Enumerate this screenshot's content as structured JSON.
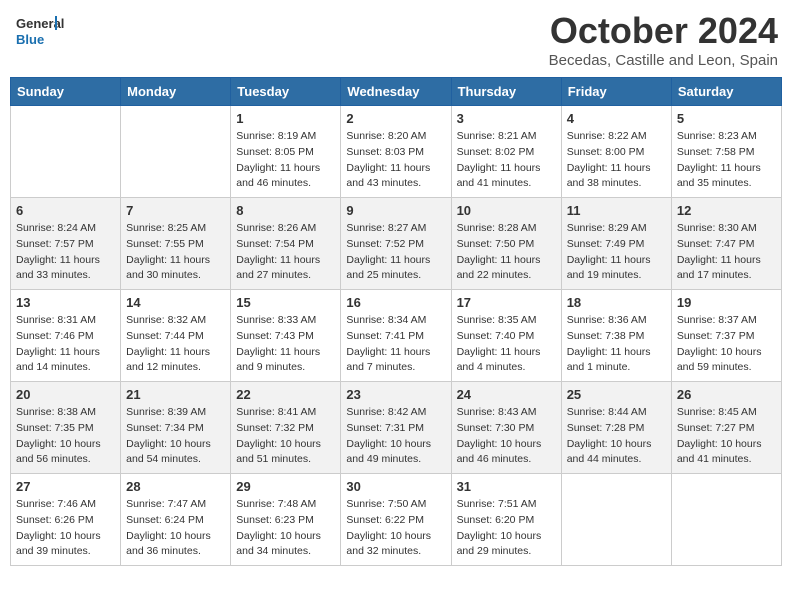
{
  "header": {
    "logo_line1": "General",
    "logo_line2": "Blue",
    "month": "October 2024",
    "location": "Becedas, Castille and Leon, Spain"
  },
  "weekdays": [
    "Sunday",
    "Monday",
    "Tuesday",
    "Wednesday",
    "Thursday",
    "Friday",
    "Saturday"
  ],
  "weeks": [
    [
      {
        "day": "",
        "sunrise": "",
        "sunset": "",
        "daylight": ""
      },
      {
        "day": "",
        "sunrise": "",
        "sunset": "",
        "daylight": ""
      },
      {
        "day": "1",
        "sunrise": "Sunrise: 8:19 AM",
        "sunset": "Sunset: 8:05 PM",
        "daylight": "Daylight: 11 hours and 46 minutes."
      },
      {
        "day": "2",
        "sunrise": "Sunrise: 8:20 AM",
        "sunset": "Sunset: 8:03 PM",
        "daylight": "Daylight: 11 hours and 43 minutes."
      },
      {
        "day": "3",
        "sunrise": "Sunrise: 8:21 AM",
        "sunset": "Sunset: 8:02 PM",
        "daylight": "Daylight: 11 hours and 41 minutes."
      },
      {
        "day": "4",
        "sunrise": "Sunrise: 8:22 AM",
        "sunset": "Sunset: 8:00 PM",
        "daylight": "Daylight: 11 hours and 38 minutes."
      },
      {
        "day": "5",
        "sunrise": "Sunrise: 8:23 AM",
        "sunset": "Sunset: 7:58 PM",
        "daylight": "Daylight: 11 hours and 35 minutes."
      }
    ],
    [
      {
        "day": "6",
        "sunrise": "Sunrise: 8:24 AM",
        "sunset": "Sunset: 7:57 PM",
        "daylight": "Daylight: 11 hours and 33 minutes."
      },
      {
        "day": "7",
        "sunrise": "Sunrise: 8:25 AM",
        "sunset": "Sunset: 7:55 PM",
        "daylight": "Daylight: 11 hours and 30 minutes."
      },
      {
        "day": "8",
        "sunrise": "Sunrise: 8:26 AM",
        "sunset": "Sunset: 7:54 PM",
        "daylight": "Daylight: 11 hours and 27 minutes."
      },
      {
        "day": "9",
        "sunrise": "Sunrise: 8:27 AM",
        "sunset": "Sunset: 7:52 PM",
        "daylight": "Daylight: 11 hours and 25 minutes."
      },
      {
        "day": "10",
        "sunrise": "Sunrise: 8:28 AM",
        "sunset": "Sunset: 7:50 PM",
        "daylight": "Daylight: 11 hours and 22 minutes."
      },
      {
        "day": "11",
        "sunrise": "Sunrise: 8:29 AM",
        "sunset": "Sunset: 7:49 PM",
        "daylight": "Daylight: 11 hours and 19 minutes."
      },
      {
        "day": "12",
        "sunrise": "Sunrise: 8:30 AM",
        "sunset": "Sunset: 7:47 PM",
        "daylight": "Daylight: 11 hours and 17 minutes."
      }
    ],
    [
      {
        "day": "13",
        "sunrise": "Sunrise: 8:31 AM",
        "sunset": "Sunset: 7:46 PM",
        "daylight": "Daylight: 11 hours and 14 minutes."
      },
      {
        "day": "14",
        "sunrise": "Sunrise: 8:32 AM",
        "sunset": "Sunset: 7:44 PM",
        "daylight": "Daylight: 11 hours and 12 minutes."
      },
      {
        "day": "15",
        "sunrise": "Sunrise: 8:33 AM",
        "sunset": "Sunset: 7:43 PM",
        "daylight": "Daylight: 11 hours and 9 minutes."
      },
      {
        "day": "16",
        "sunrise": "Sunrise: 8:34 AM",
        "sunset": "Sunset: 7:41 PM",
        "daylight": "Daylight: 11 hours and 7 minutes."
      },
      {
        "day": "17",
        "sunrise": "Sunrise: 8:35 AM",
        "sunset": "Sunset: 7:40 PM",
        "daylight": "Daylight: 11 hours and 4 minutes."
      },
      {
        "day": "18",
        "sunrise": "Sunrise: 8:36 AM",
        "sunset": "Sunset: 7:38 PM",
        "daylight": "Daylight: 11 hours and 1 minute."
      },
      {
        "day": "19",
        "sunrise": "Sunrise: 8:37 AM",
        "sunset": "Sunset: 7:37 PM",
        "daylight": "Daylight: 10 hours and 59 minutes."
      }
    ],
    [
      {
        "day": "20",
        "sunrise": "Sunrise: 8:38 AM",
        "sunset": "Sunset: 7:35 PM",
        "daylight": "Daylight: 10 hours and 56 minutes."
      },
      {
        "day": "21",
        "sunrise": "Sunrise: 8:39 AM",
        "sunset": "Sunset: 7:34 PM",
        "daylight": "Daylight: 10 hours and 54 minutes."
      },
      {
        "day": "22",
        "sunrise": "Sunrise: 8:41 AM",
        "sunset": "Sunset: 7:32 PM",
        "daylight": "Daylight: 10 hours and 51 minutes."
      },
      {
        "day": "23",
        "sunrise": "Sunrise: 8:42 AM",
        "sunset": "Sunset: 7:31 PM",
        "daylight": "Daylight: 10 hours and 49 minutes."
      },
      {
        "day": "24",
        "sunrise": "Sunrise: 8:43 AM",
        "sunset": "Sunset: 7:30 PM",
        "daylight": "Daylight: 10 hours and 46 minutes."
      },
      {
        "day": "25",
        "sunrise": "Sunrise: 8:44 AM",
        "sunset": "Sunset: 7:28 PM",
        "daylight": "Daylight: 10 hours and 44 minutes."
      },
      {
        "day": "26",
        "sunrise": "Sunrise: 8:45 AM",
        "sunset": "Sunset: 7:27 PM",
        "daylight": "Daylight: 10 hours and 41 minutes."
      }
    ],
    [
      {
        "day": "27",
        "sunrise": "Sunrise: 7:46 AM",
        "sunset": "Sunset: 6:26 PM",
        "daylight": "Daylight: 10 hours and 39 minutes."
      },
      {
        "day": "28",
        "sunrise": "Sunrise: 7:47 AM",
        "sunset": "Sunset: 6:24 PM",
        "daylight": "Daylight: 10 hours and 36 minutes."
      },
      {
        "day": "29",
        "sunrise": "Sunrise: 7:48 AM",
        "sunset": "Sunset: 6:23 PM",
        "daylight": "Daylight: 10 hours and 34 minutes."
      },
      {
        "day": "30",
        "sunrise": "Sunrise: 7:50 AM",
        "sunset": "Sunset: 6:22 PM",
        "daylight": "Daylight: 10 hours and 32 minutes."
      },
      {
        "day": "31",
        "sunrise": "Sunrise: 7:51 AM",
        "sunset": "Sunset: 6:20 PM",
        "daylight": "Daylight: 10 hours and 29 minutes."
      },
      {
        "day": "",
        "sunrise": "",
        "sunset": "",
        "daylight": ""
      },
      {
        "day": "",
        "sunrise": "",
        "sunset": "",
        "daylight": ""
      }
    ]
  ]
}
